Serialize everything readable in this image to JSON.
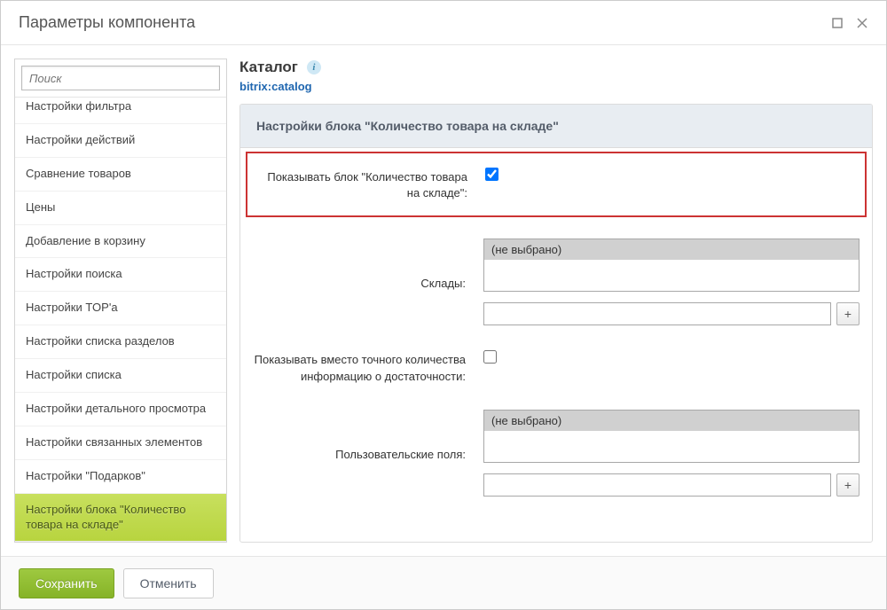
{
  "modal": {
    "title": "Параметры компонента"
  },
  "search": {
    "placeholder": "Поиск"
  },
  "sidebar": {
    "items": [
      {
        "label": "Настройки фильтра"
      },
      {
        "label": "Настройки действий"
      },
      {
        "label": "Сравнение товаров"
      },
      {
        "label": "Цены"
      },
      {
        "label": "Добавление в корзину"
      },
      {
        "label": "Настройки поиска"
      },
      {
        "label": "Настройки TOP'а"
      },
      {
        "label": "Настройки списка разделов"
      },
      {
        "label": "Настройки списка"
      },
      {
        "label": "Настройки детального просмотра"
      },
      {
        "label": "Настройки связанных элементов"
      },
      {
        "label": "Настройки \"Подарков\""
      },
      {
        "label": "Настройки блока \"Количество товара на складе\""
      }
    ],
    "active_index": 12
  },
  "main": {
    "title": "Каталог",
    "component": "bitrix:catalog",
    "info_glyph": "i",
    "section_header": "Настройки блока \"Количество товара на складе\"",
    "fields": {
      "show_block": {
        "label": "Показывать блок \"Количество товара на складе\":",
        "checked": true
      },
      "stores": {
        "label": "Склады:",
        "selected_option": "(не выбрано)",
        "input_value": "",
        "add_glyph": "+"
      },
      "show_sufficiency": {
        "label": "Показывать вместо точного количества информацию о достаточности:",
        "checked": false
      },
      "user_fields": {
        "label": "Пользовательские поля:",
        "selected_option": "(не выбрано)",
        "input_value": "",
        "add_glyph": "+"
      }
    }
  },
  "footer": {
    "save": "Сохранить",
    "cancel": "Отменить"
  }
}
